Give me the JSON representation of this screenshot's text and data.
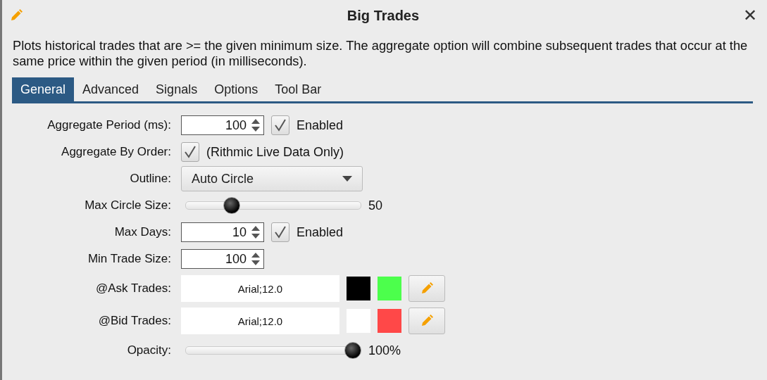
{
  "window": {
    "title": "Big Trades"
  },
  "close": "✕",
  "description": "Plots historical trades that are >= the given minimum size.  The aggregate option will combine subsequent trades that occur at the same price within the given period (in milliseconds).",
  "tabs": [
    {
      "label": "General",
      "selected": true
    },
    {
      "label": "Advanced",
      "selected": false
    },
    {
      "label": "Signals",
      "selected": false
    },
    {
      "label": "Options",
      "selected": false
    },
    {
      "label": "Tool Bar",
      "selected": false
    }
  ],
  "rows": [
    {
      "kind": "spinner",
      "label": "Aggregate Period (ms):",
      "value": "100",
      "checkbox": {
        "checked": true,
        "label": "Enabled"
      }
    },
    {
      "kind": "checkbox",
      "label": "Aggregate By Order:",
      "checkbox": {
        "checked": true,
        "label": "(Rithmic Live Data Only)"
      }
    },
    {
      "kind": "dropdown",
      "label": "Outline:",
      "value": "Auto Circle"
    },
    {
      "kind": "slider",
      "label": "Max Circle Size:",
      "level": 0.24,
      "reading": "50"
    },
    {
      "kind": "spinner",
      "label": "Max Days:",
      "value": "10",
      "checkbox": {
        "checked": true,
        "label": "Enabled"
      }
    },
    {
      "kind": "spinner",
      "label": "Min Trade Size:",
      "value": "100"
    },
    {
      "kind": "font",
      "label": "@Ask Trades:",
      "value": "Arial;12.0",
      "colors": [
        {
          "color": "#000000"
        },
        {
          "color": "#4cff4c"
        }
      ]
    },
    {
      "kind": "font",
      "label": "@Bid Trades:",
      "value": "Arial;12.0",
      "colors": [
        {
          "color": "#ffffff"
        },
        {
          "color": "#ff4848"
        }
      ]
    },
    {
      "kind": "slider",
      "label": "Opacity:",
      "level": 1.0,
      "reading": "100%"
    }
  ]
}
